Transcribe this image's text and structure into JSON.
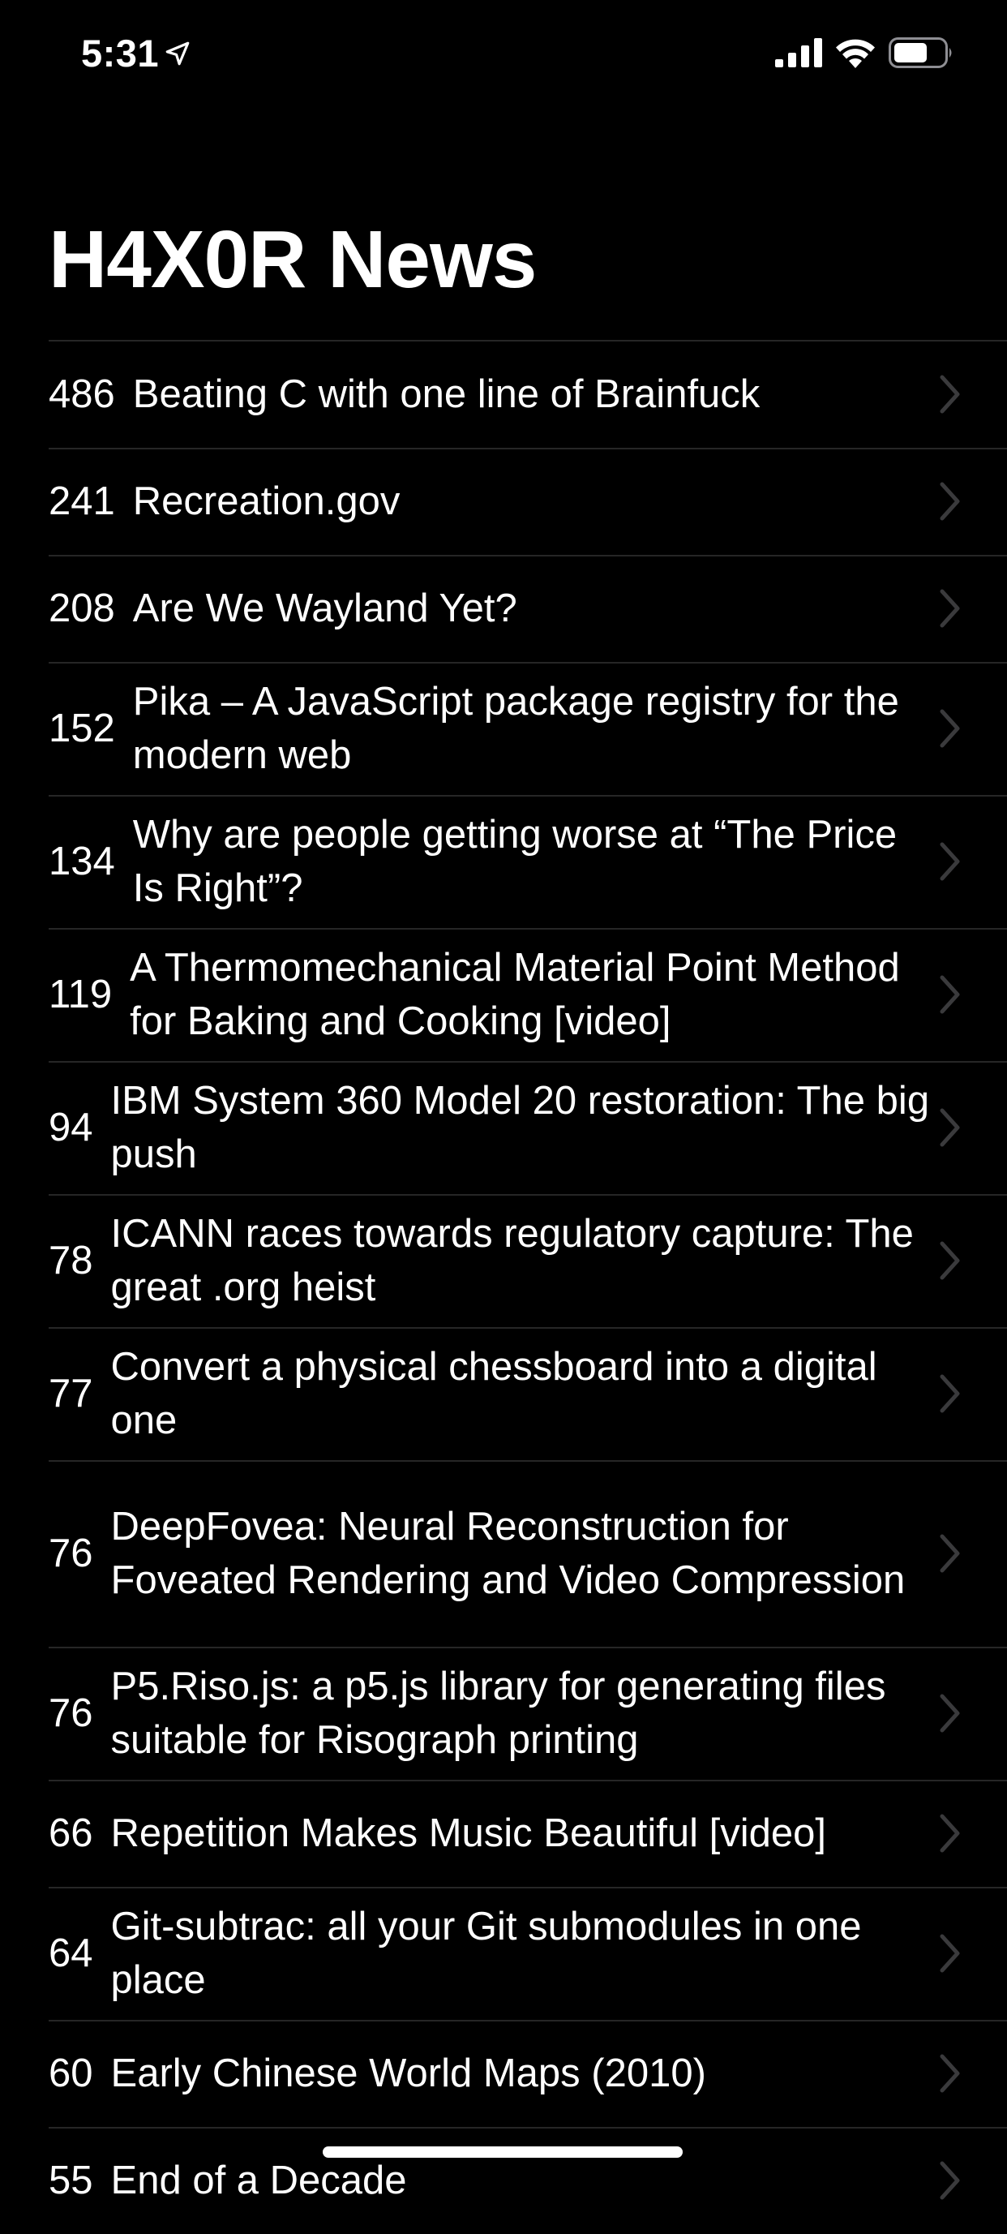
{
  "status_bar": {
    "time": "5:31",
    "location_icon": "location-arrow-icon",
    "signal_icon": "cellular-signal-icon",
    "wifi_icon": "wifi-icon",
    "battery_icon": "battery-icon"
  },
  "nav": {
    "title": "H4X0R News"
  },
  "stories": [
    {
      "points": "486",
      "title": "Beating C with one line of Brainfuck"
    },
    {
      "points": "241",
      "title": "Recreation.gov"
    },
    {
      "points": "208",
      "title": "Are We Wayland Yet?"
    },
    {
      "points": "152",
      "title": "Pika – A JavaScript package registry for the modern web"
    },
    {
      "points": "134",
      "title": "Why are people getting worse at “The Price Is Right”?"
    },
    {
      "points": "119",
      "title": "A Thermomechanical Material Point Method for Baking and Cooking [video]"
    },
    {
      "points": "94",
      "title": "IBM System 360 Model 20 restoration: The big push"
    },
    {
      "points": "78",
      "title": "ICANN races towards regulatory capture: The great .org heist"
    },
    {
      "points": "77",
      "title": "Convert a physical chessboard into a digital one"
    },
    {
      "points": "76",
      "title": "DeepFovea: Neural Reconstruction for Foveated Rendering and Video Compression"
    },
    {
      "points": "76",
      "title": "P5.Riso.js: a p5.js library for generating files suitable for Risograph printing"
    },
    {
      "points": "66",
      "title": "Repetition Makes Music Beautiful [video]"
    },
    {
      "points": "64",
      "title": "Git-subtrac: all your Git submodules in one place"
    },
    {
      "points": "60",
      "title": "Early Chinese World Maps (2010)"
    },
    {
      "points": "55",
      "title": "End of a Decade"
    }
  ],
  "colors": {
    "background": "#000000",
    "text": "#ffffff",
    "separator": "#262626",
    "chevron": "#3a3a3c"
  }
}
